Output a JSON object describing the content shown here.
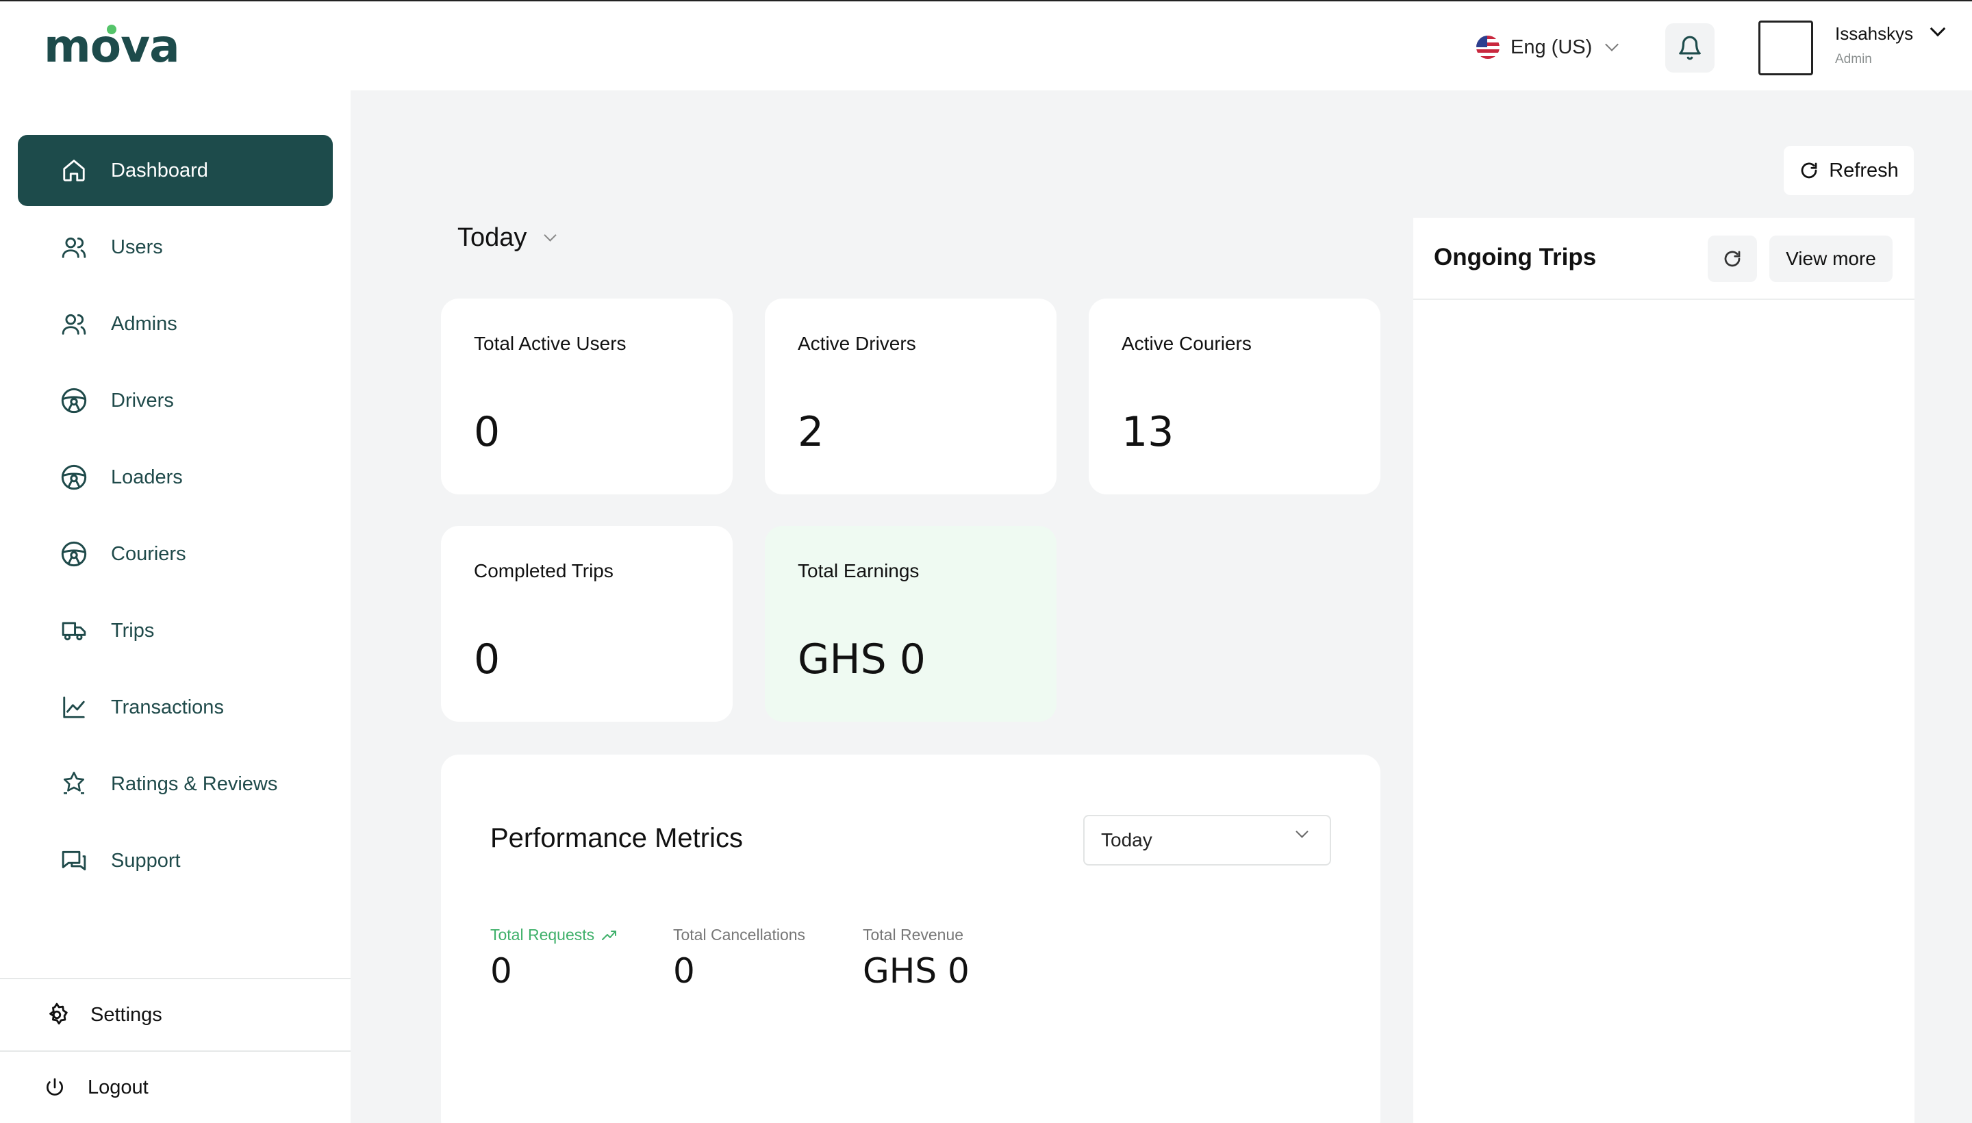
{
  "app": {
    "logo_text": "mova",
    "brand_color": "#1d4b4b",
    "accent_color": "#55c46a"
  },
  "header": {
    "language": "Eng (US)",
    "language_flag": "us-flag-icon",
    "user_name": "Issahskys",
    "user_role": "Admin"
  },
  "sidebar": {
    "items": [
      {
        "label": "Dashboard",
        "icon": "home-icon",
        "active": true
      },
      {
        "label": "Users",
        "icon": "users-icon"
      },
      {
        "label": "Admins",
        "icon": "users-icon"
      },
      {
        "label": "Drivers",
        "icon": "steering-wheel-icon"
      },
      {
        "label": "Loaders",
        "icon": "steering-wheel-icon"
      },
      {
        "label": "Couriers",
        "icon": "steering-wheel-icon"
      },
      {
        "label": "Trips",
        "icon": "truck-icon"
      },
      {
        "label": "Transactions",
        "icon": "line-chart-icon"
      },
      {
        "label": "Ratings & Reviews",
        "icon": "star-badge-icon"
      },
      {
        "label": "Support",
        "icon": "chat-icon"
      }
    ],
    "settings_label": "Settings",
    "logout_label": "Logout"
  },
  "main": {
    "refresh_label": "Refresh",
    "period_label": "Today",
    "cards": [
      {
        "label": "Total Active Users",
        "value": "0"
      },
      {
        "label": "Active Drivers",
        "value": "2"
      },
      {
        "label": "Active Couriers",
        "value": "13"
      },
      {
        "label": "Completed Trips",
        "value": "0"
      },
      {
        "label": "Total Earnings",
        "value": "GHS 0"
      }
    ],
    "performance": {
      "title": "Performance Metrics",
      "period_select": "Today",
      "metrics": [
        {
          "label": "Total Requests",
          "value": "0"
        },
        {
          "label": "Total Cancellations",
          "value": "0"
        },
        {
          "label": "Total Revenue",
          "value": "GHS 0"
        }
      ]
    },
    "ongoing_trips": {
      "title": "Ongoing Trips",
      "view_more_label": "View more"
    }
  }
}
